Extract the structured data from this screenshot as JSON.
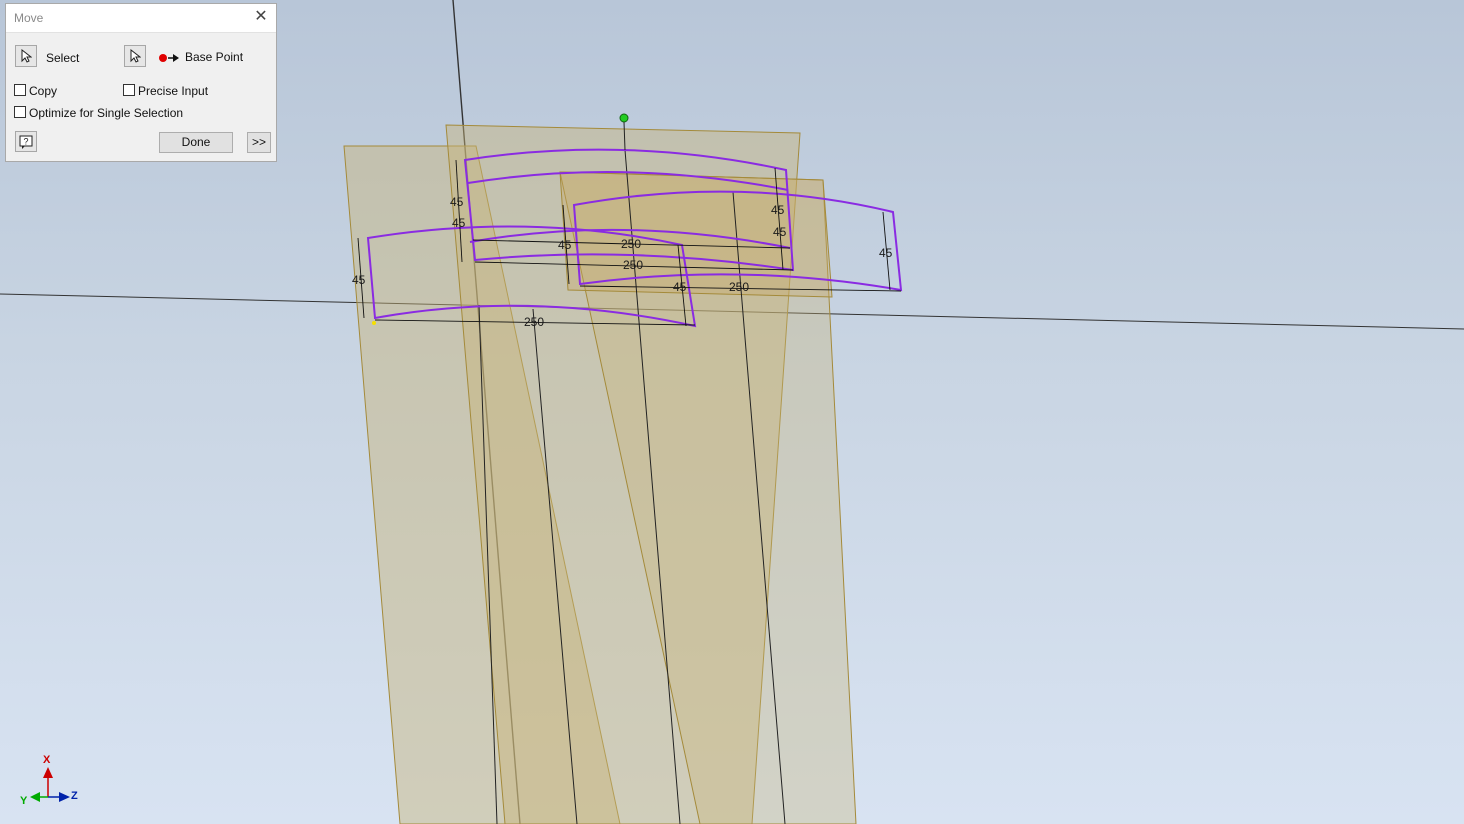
{
  "dialog": {
    "title": "Move",
    "select_label": "Select",
    "base_point_label": "Base Point",
    "copy_label": "Copy",
    "precise_input_label": "Precise Input",
    "optimize_label": "Optimize for Single Selection",
    "done_label": "Done",
    "more_label": ">>",
    "copy_checked": false,
    "precise_input_checked": false,
    "optimize_checked": false
  },
  "dimensions": {
    "d1": "45",
    "d2": "45",
    "d3": "45",
    "d4": "45",
    "d5": "45",
    "d6": "45",
    "d7": "45",
    "d8": "45",
    "d9": "250",
    "d10": "250",
    "d11": "250",
    "d12": "250"
  },
  "view_cube": {
    "x_label": "X",
    "y_label": "Y",
    "z_label": "Z"
  },
  "colors": {
    "sketch_profile": "#8a2be2",
    "plane_fill": "#c8b478",
    "base_point": "#e00000",
    "ground_point": "#22cc22"
  }
}
